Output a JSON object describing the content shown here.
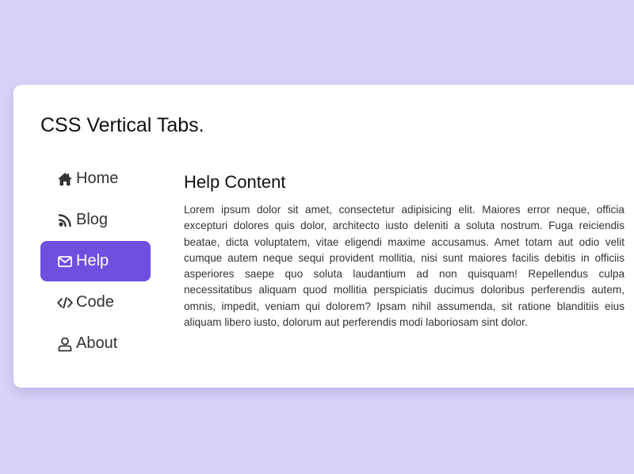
{
  "page": {
    "title": "CSS Vertical Tabs."
  },
  "tabs": [
    {
      "label": "Home",
      "icon": "home-icon",
      "active": false
    },
    {
      "label": "Blog",
      "icon": "blog-rss-icon",
      "active": false
    },
    {
      "label": "Help",
      "icon": "envelope-icon",
      "active": true
    },
    {
      "label": "Code",
      "icon": "code-icon",
      "active": false
    },
    {
      "label": "About",
      "icon": "user-icon",
      "active": false
    }
  ],
  "content": {
    "title": "Help Content",
    "body": "Lorem ipsum dolor sit amet, consectetur adipisicing elit. Maiores error neque, officia excepturi dolores quis dolor, architecto iusto deleniti a soluta nostrum. Fuga reiciendis beatae, dicta voluptatem, vitae eligendi maxime accusamus. Amet totam aut odio velit cumque autem neque sequi provident mollitia, nisi sunt maiores facilis debitis in officiis asperiores saepe quo soluta laudantium ad non quisquam! Repellendus culpa necessitatibus aliquam quod mollitia perspiciatis ducimus doloribus perferendis autem, omnis, impedit, veniam qui dolorem? Ipsam nihil assumenda, sit ratione blanditiis eius aliquam libero iusto, dolorum aut perferendis modi laboriosam sint dolor."
  },
  "colors": {
    "background": "#d9d2f7",
    "accent": "#6e4fe0",
    "card": "#ffffff",
    "text": "#333333"
  }
}
